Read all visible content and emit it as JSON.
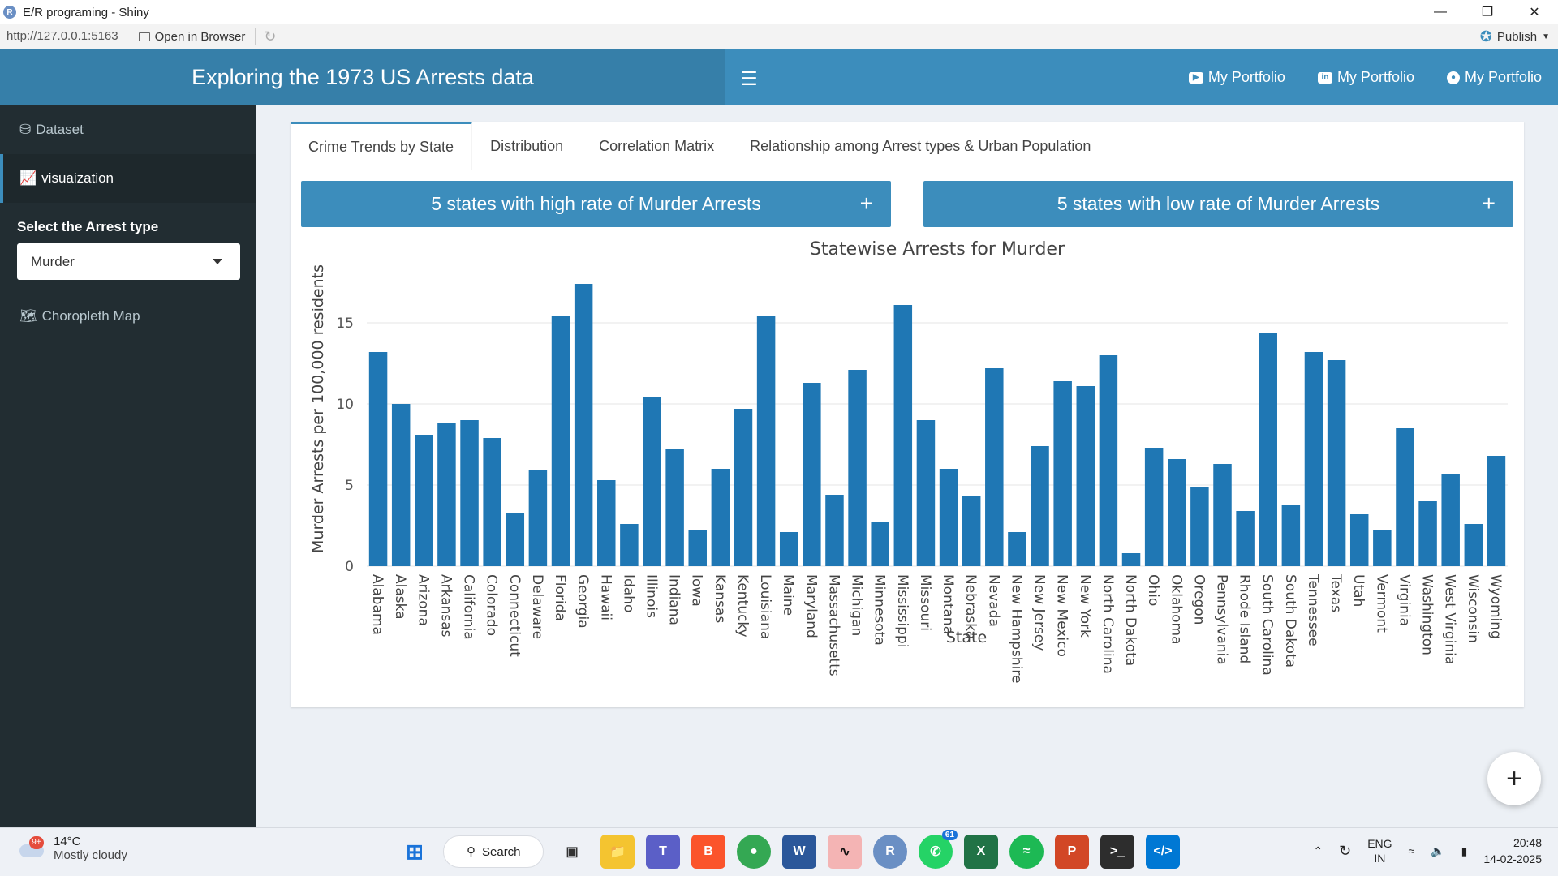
{
  "window": {
    "title": "E/R programing - Shiny",
    "logo": "R",
    "controls": [
      "minimize-icon",
      "restore-icon",
      "close-icon"
    ]
  },
  "address_bar": {
    "url": "http://127.0.0.1:5163",
    "open_in_browser": "Open in Browser",
    "publish": "Publish"
  },
  "header": {
    "title": "Exploring the 1973 US Arrests data",
    "links": [
      {
        "label": "My Portfolio",
        "icon": "youtube-icon"
      },
      {
        "label": "My Portfolio",
        "icon": "linkedin-icon"
      },
      {
        "label": "My Portfolio",
        "icon": "github-icon"
      }
    ]
  },
  "sidebar": {
    "items": [
      {
        "label": "Dataset",
        "icon": "database-icon",
        "active": false
      },
      {
        "label": "visuaization",
        "icon": "line-chart-icon",
        "active": true
      }
    ],
    "select_label": "Select the Arrest type",
    "select_value": "Murder",
    "map_item": {
      "label": "Choropleth Map",
      "icon": "map-icon"
    }
  },
  "tabs": [
    {
      "label": "Crime Trends by State",
      "active": true
    },
    {
      "label": "Distribution",
      "active": false
    },
    {
      "label": "Correlation Matrix",
      "active": false
    },
    {
      "label": "Relationship among Arrest types & Urban Population",
      "active": false
    }
  ],
  "boxes": {
    "high": "5 states with high rate of Murder Arrests",
    "low": "5 states with low rate of Murder Arrests",
    "plus": "+"
  },
  "fab": "+",
  "colors": {
    "bar": "#1f77b4",
    "header": "#3c8dbc",
    "header_logo": "#367fa9",
    "sidebar": "#222d32"
  },
  "chart_data": {
    "type": "bar",
    "title": "Statewise Arrests for Murder",
    "xlabel": "State",
    "ylabel": "Murder Arrests per 100,000 residents",
    "ylim": [
      0,
      17.4
    ],
    "yticks": [
      0,
      5,
      10,
      15
    ],
    "grid": true,
    "categories": [
      "Alabama",
      "Alaska",
      "Arizona",
      "Arkansas",
      "California",
      "Colorado",
      "Connecticut",
      "Delaware",
      "Florida",
      "Georgia",
      "Hawaii",
      "Idaho",
      "Illinois",
      "Indiana",
      "Iowa",
      "Kansas",
      "Kentucky",
      "Louisiana",
      "Maine",
      "Maryland",
      "Massachusetts",
      "Michigan",
      "Minnesota",
      "Mississippi",
      "Missouri",
      "Montana",
      "Nebraska",
      "Nevada",
      "New Hampshire",
      "New Jersey",
      "New Mexico",
      "New York",
      "North Carolina",
      "North Dakota",
      "Ohio",
      "Oklahoma",
      "Oregon",
      "Pennsylvania",
      "Rhode Island",
      "South Carolina",
      "South Dakota",
      "Tennessee",
      "Texas",
      "Utah",
      "Vermont",
      "Virginia",
      "Washington",
      "West Virginia",
      "Wisconsin",
      "Wyoming"
    ],
    "values": [
      13.2,
      10,
      8.1,
      8.8,
      9,
      7.9,
      3.3,
      5.9,
      15.4,
      17.4,
      5.3,
      2.6,
      10.4,
      7.2,
      2.2,
      6,
      9.7,
      15.4,
      2.1,
      11.3,
      4.4,
      12.1,
      2.7,
      16.1,
      9,
      6,
      4.3,
      12.2,
      2.1,
      7.4,
      11.4,
      11.1,
      13,
      0.8,
      7.3,
      6.6,
      4.9,
      6.3,
      3.4,
      14.4,
      3.8,
      13.2,
      12.7,
      3.2,
      2.2,
      8.5,
      4,
      5.7,
      2.6,
      6.8
    ]
  },
  "taskbar": {
    "weather_temp": "14°C",
    "weather_desc": "Mostly cloudy",
    "weather_badge": "9+",
    "search": "Search",
    "apps": [
      "windows-start-icon",
      "task-view-icon",
      "file-explorer-icon",
      "teams-icon",
      "brave-icon",
      "chrome-icon",
      "word-icon",
      "waves-icon",
      "r-icon",
      "whatsapp-icon",
      "excel-icon",
      "spotify-icon",
      "powerpoint-icon",
      "terminal-icon",
      "vscode-icon"
    ],
    "whatsapp_badge": "61",
    "lang": "ENG",
    "region": "IN",
    "time": "20:48",
    "date": "14-02-2025"
  }
}
